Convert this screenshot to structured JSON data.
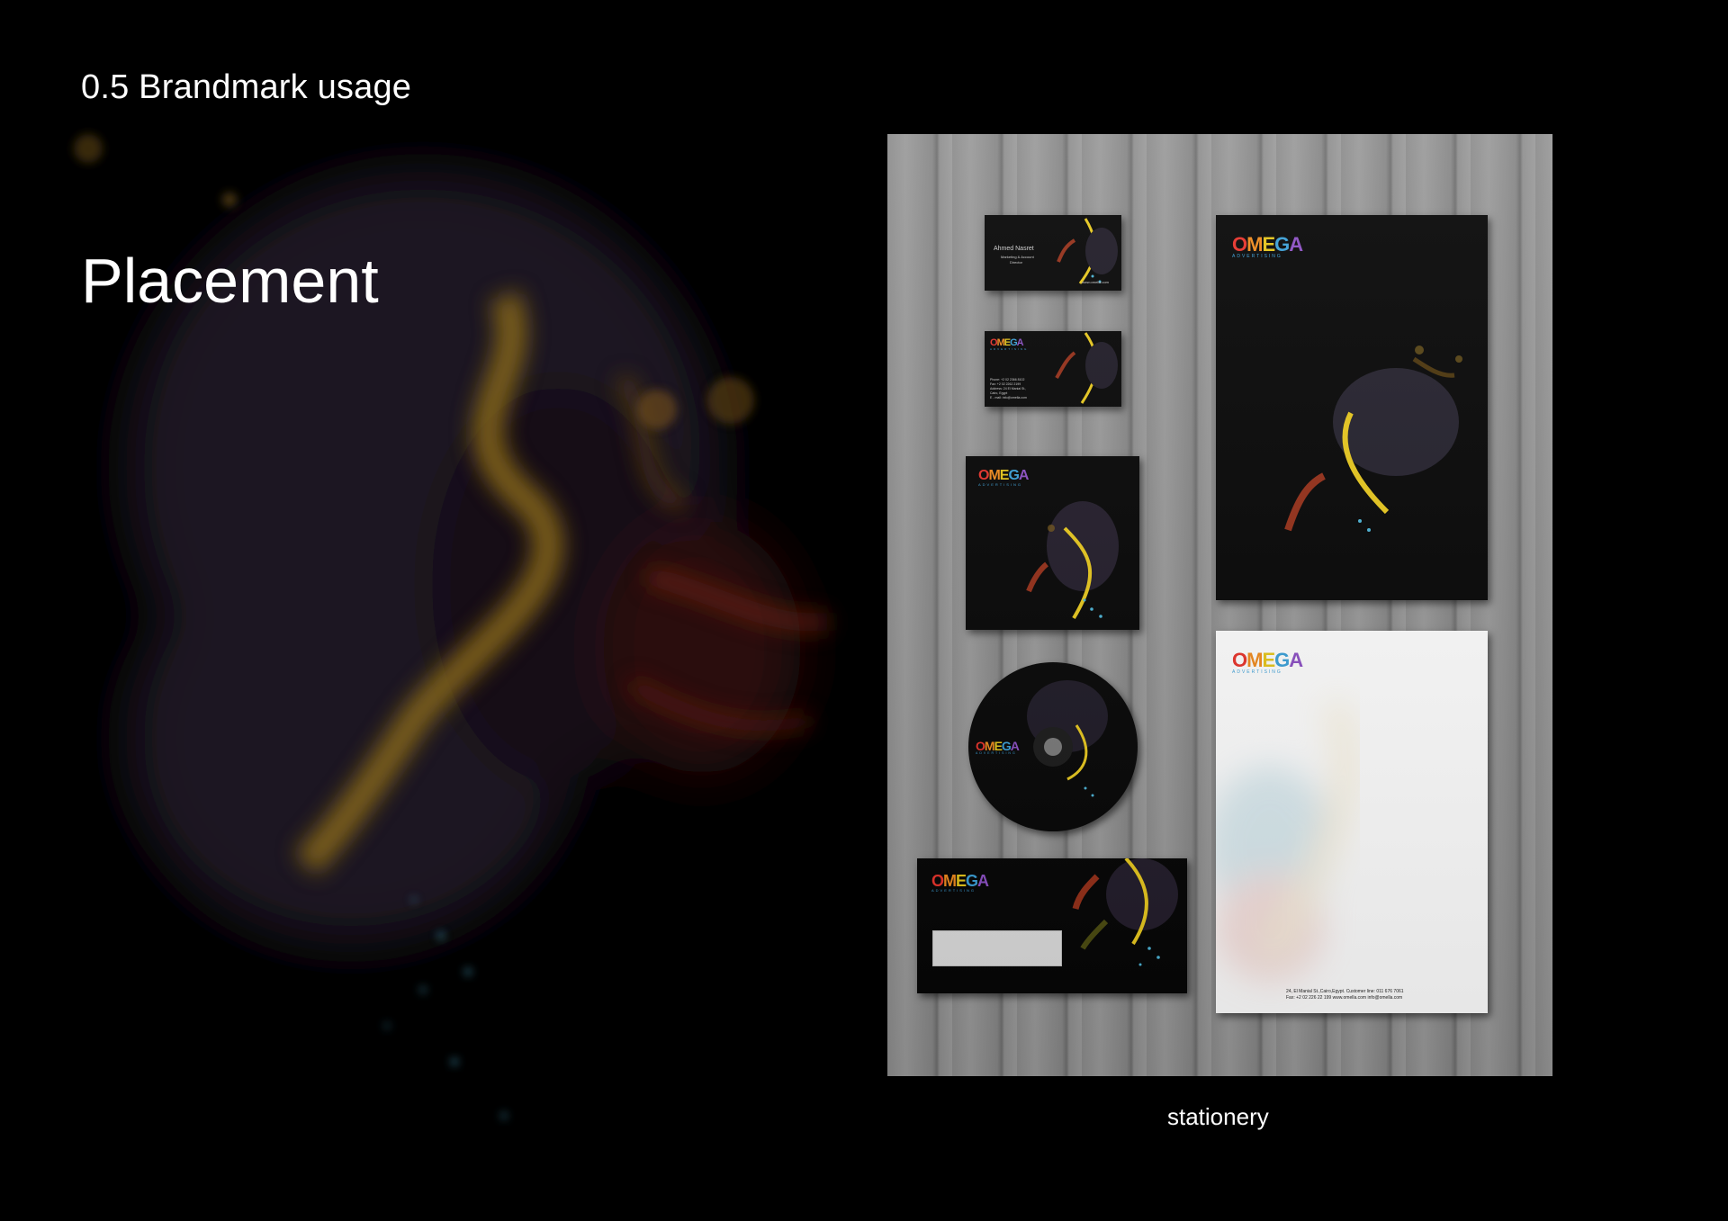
{
  "header": {
    "section_label": "0.5 Brandmark usage",
    "title": "Placement"
  },
  "mockup": {
    "caption": "stationery",
    "brand": {
      "wordmark": [
        "O",
        "M",
        "E",
        "G",
        "A"
      ],
      "tagline": "ADVERTISING"
    },
    "business_card_front": {
      "name": "Ahmed Nasret",
      "role_line_1": "Marketing & Account",
      "role_line_2": "Director",
      "website": "www.omella.com"
    },
    "business_card_back": {
      "contact_lines": [
        "Phone:    +2 02 2366 8102",
        "Fax:      +2 02 2262 2199",
        "Address:  24 El Manial St.,",
        "          Cairo, Egypt",
        "E - mail: info@omella.com"
      ]
    },
    "letterhead": {
      "footer_line_1": "24, El Manial St.,Cairo,Egypt.   Customer line: 011 676 7061",
      "footer_line_2": "Fax: +2 02 226 22 199   www.omella.com   info@omella.com"
    }
  }
}
